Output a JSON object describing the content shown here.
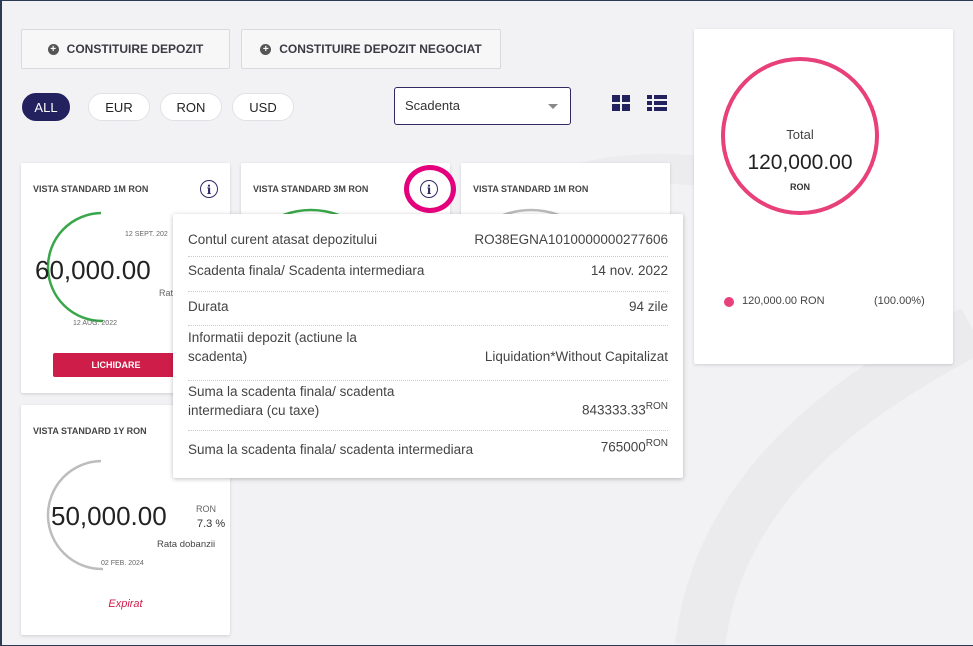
{
  "actions": {
    "constituire_depozit": "CONSTITUIRE DEPOZIT",
    "constituire_depozit_negociat": "CONSTITUIRE DEPOZIT NEGOCIAT"
  },
  "filters": {
    "currencies": [
      "ALL",
      "EUR",
      "RON",
      "USD"
    ],
    "active": "ALL",
    "sort_value": "Scadenta"
  },
  "cards": [
    {
      "title": "VISTA STANDARD 1M RON",
      "amount": "60,000.00",
      "maturity_date": "12 SEPT. 202",
      "start_date": "12 AUG. 2022",
      "rate_label": "Rat",
      "action_label": "LICHIDARE"
    },
    {
      "title": "VISTA STANDARD 3M RON"
    },
    {
      "title": "VISTA STANDARD 1M RON"
    },
    {
      "title": "VISTA STANDARD 1Y RON",
      "amount": "50,000.00",
      "currency": "RON",
      "rate": "7.3 %",
      "rate_label": "Rata dobanzii",
      "start_date": "02 FEB. 2024",
      "status": "Expirat"
    }
  ],
  "tooltip": {
    "rows": [
      {
        "label": "Contul curent atasat depozitului",
        "value": "RO38EGNA1010000000277606"
      },
      {
        "label": "Scadenta finala/ Scadenta intermediara",
        "value": "14 nov. 2022"
      },
      {
        "label": "Durata",
        "value": "94 zile"
      },
      {
        "label_line1": "Informatii depozit (actiune la",
        "label_line2": "scadenta)",
        "value": "Liquidation*Without Capitalizat"
      },
      {
        "label_line1": "Suma la scadenta finala/ scadenta",
        "label_line2": "intermediara (cu taxe)",
        "value": "843333.33",
        "unit": "RON"
      },
      {
        "label": "Suma la scadenta finala/ scadenta intermediara",
        "value": "765000",
        "unit": "RON"
      }
    ]
  },
  "summary": {
    "total_label": "Total",
    "total_amount": "120,000.00",
    "currency": "RON",
    "legend_amount": "120,000.00 RON",
    "legend_percent": "(100.00%)",
    "ring_color": "#e8407a"
  },
  "colors": {
    "accent": "#24215f",
    "danger": "#cf1d4a",
    "green": "#3aa64a",
    "highlight": "#e4007c"
  }
}
